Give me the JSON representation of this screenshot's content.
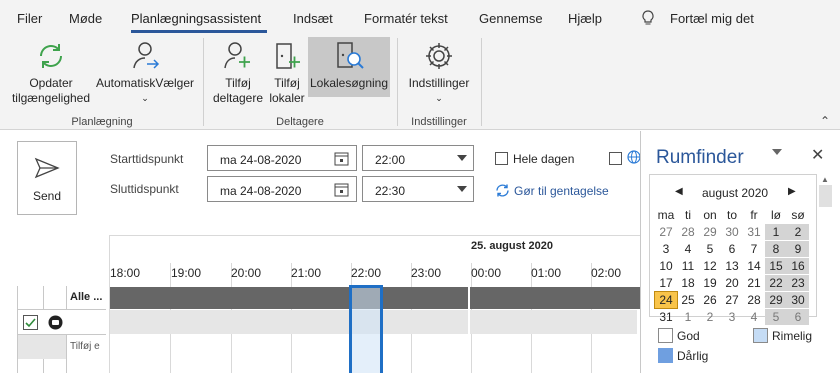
{
  "tabs": [
    {
      "label": "Filer"
    },
    {
      "label": "Møde"
    },
    {
      "label": "Planlægningsassistent"
    },
    {
      "label": "Indsæt"
    },
    {
      "label": "Formatér tekst"
    },
    {
      "label": "Gennemse"
    },
    {
      "label": "Hjælp"
    },
    {
      "label": "Fortæl mig det"
    }
  ],
  "ribbon": {
    "update_line1": "Opdater",
    "update_line2": "tilgængelighed",
    "autopicker": "AutomatiskVælger",
    "add_attendees_line1": "Tilføj",
    "add_attendees_line2": "deltagere",
    "add_rooms_line1": "Tilføj",
    "add_rooms_line2": "lokaler",
    "room_search": "Lokalesøgning",
    "settings": "Indstillinger",
    "group_planning": "Planlægning",
    "group_attendees": "Deltagere",
    "group_settings": "Indstillinger"
  },
  "form": {
    "send": "Send",
    "start_label": "Starttidspunkt",
    "end_label": "Sluttidspunkt",
    "start_date": "ma 24-08-2020",
    "start_time": "22:00",
    "end_date": "ma 24-08-2020",
    "end_time": "22:30",
    "all_day": "Hele dagen",
    "recurrence": "Gør til gentagelse"
  },
  "schedule": {
    "date_header": "25. august 2020",
    "hours": [
      "18:00",
      "19:00",
      "20:00",
      "21:00",
      "22:00",
      "23:00",
      "00:00",
      "01:00",
      "02:00"
    ],
    "col_all": "Alle ...",
    "row_add": "Tilføj e"
  },
  "roomfinder": {
    "title": "Rumfinder",
    "month": "august 2020",
    "weekdays": [
      "ma",
      "ti",
      "on",
      "to",
      "fr",
      "lø",
      "sø"
    ],
    "weeks": [
      [
        "27",
        "28",
        "29",
        "30",
        "31",
        "1",
        "2"
      ],
      [
        "3",
        "4",
        "5",
        "6",
        "7",
        "8",
        "9"
      ],
      [
        "10",
        "11",
        "12",
        "13",
        "14",
        "15",
        "16"
      ],
      [
        "17",
        "18",
        "19",
        "20",
        "21",
        "22",
        "23"
      ],
      [
        "24",
        "25",
        "26",
        "27",
        "28",
        "29",
        "30"
      ],
      [
        "31",
        "1",
        "2",
        "3",
        "4",
        "5",
        "6"
      ]
    ],
    "legend_good": "God",
    "legend_fair": "Rimelig",
    "legend_poor": "Dårlig",
    "colors": {
      "good": "#ffffff",
      "fair": "#c5dcf5",
      "poor": "#6f9fe0",
      "selected": "#f9c44a",
      "accent": "#2b579a"
    }
  }
}
